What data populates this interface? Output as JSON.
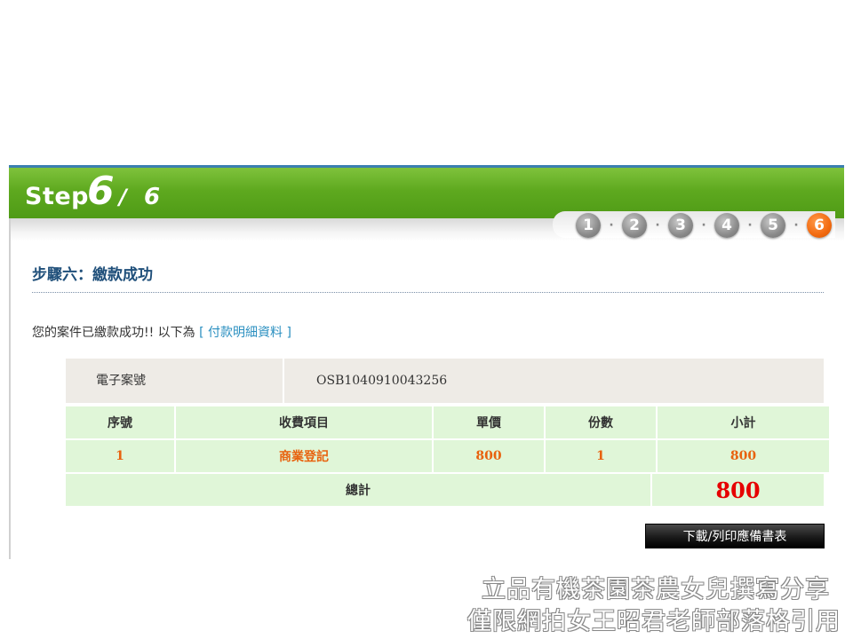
{
  "header": {
    "step_word": "Step",
    "current_step": "6",
    "separator": "/",
    "total_steps": "6",
    "steps": [
      "1",
      "2",
      "3",
      "4",
      "5",
      "6"
    ],
    "step_dot": "·"
  },
  "section_title": "步驟六：繳款成功",
  "notice": {
    "text": "您的案件已繳款成功!! 以下為",
    "link": "[ 付款明細資料 ]"
  },
  "case": {
    "label": "電子案號",
    "value": "OSB1040910043256"
  },
  "table": {
    "headers": [
      "序號",
      "收費項目",
      "單價",
      "份數",
      "小計"
    ],
    "rows": [
      [
        "1",
        "商業登記",
        "800",
        "1",
        "800"
      ]
    ],
    "total_label": "總計",
    "total_value": "800"
  },
  "download_button": "下載/列印應備書表",
  "watermark": {
    "line1": "立品有機茶園茶農女兒撰寫分享",
    "line2": "僅限網拍女王昭君老師部落格引用"
  },
  "colors": {
    "banner_green": "#5ea91f",
    "active_step": "#f26a10",
    "value_orange": "#e8620e",
    "total_red": "#e60000",
    "cell_green": "#e0f6d8"
  }
}
